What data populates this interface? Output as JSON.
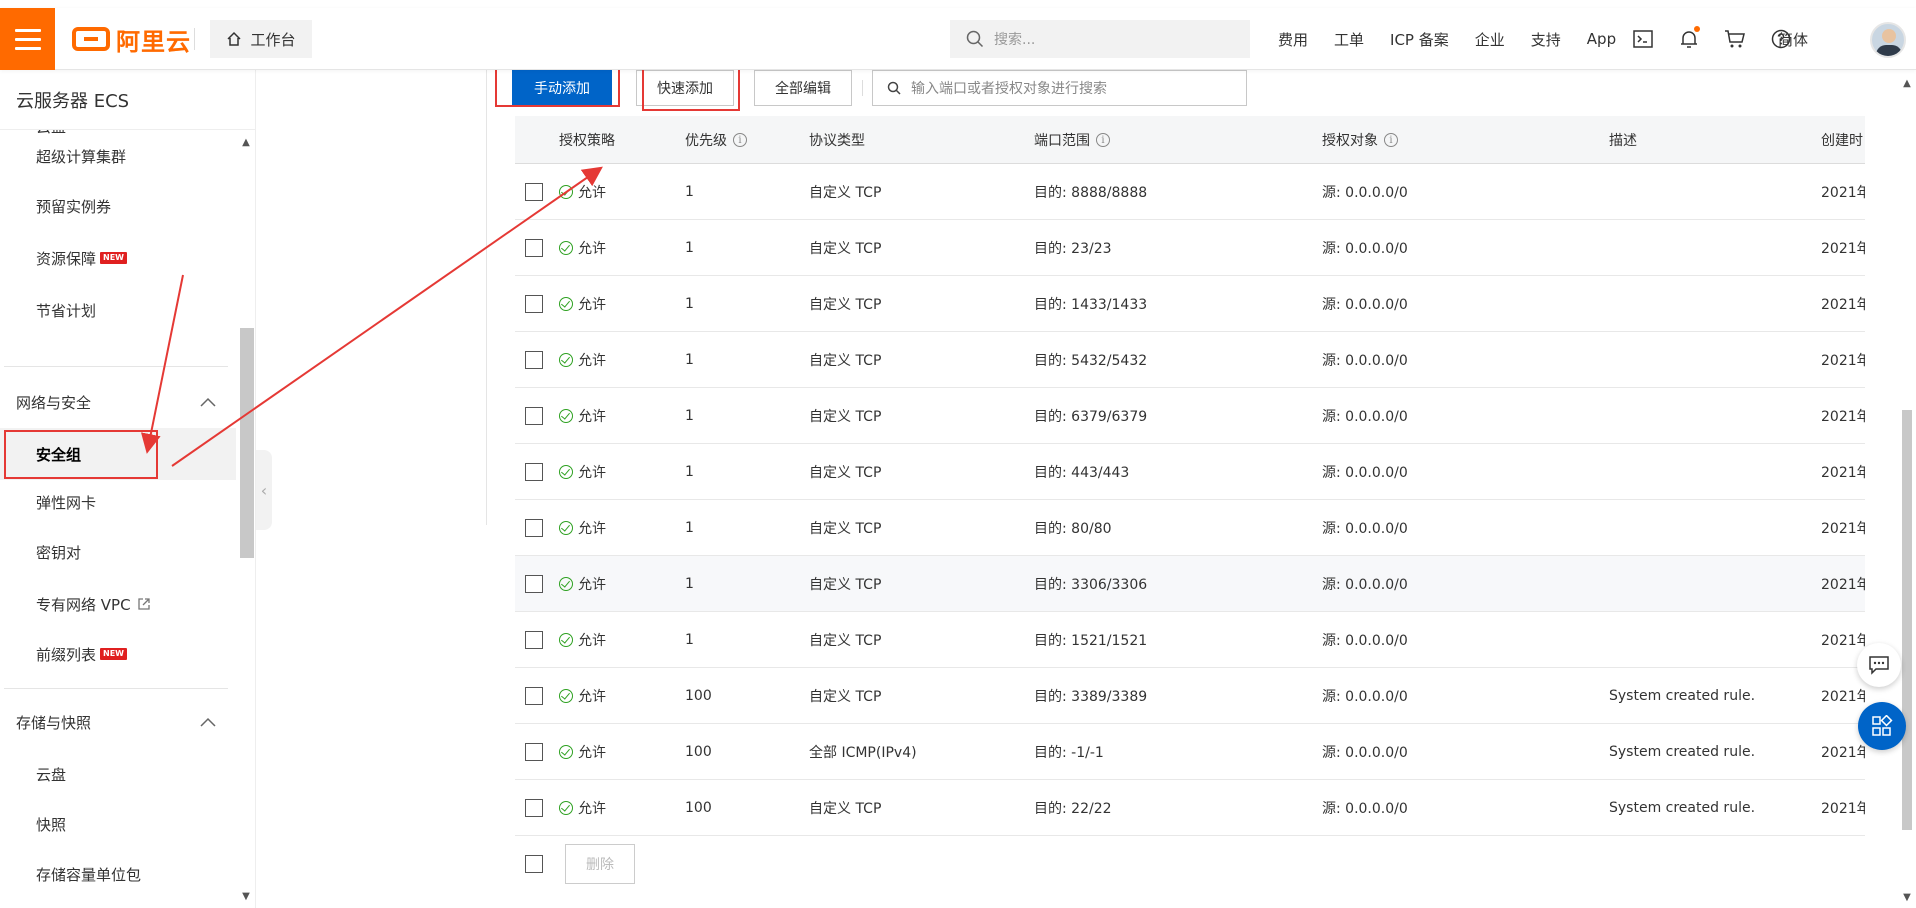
{
  "header": {
    "brand": "阿里云",
    "workbench": "工作台",
    "search_placeholder": "搜索...",
    "links": [
      "费用",
      "工单",
      "ICP 备案",
      "企业",
      "支持",
      "App"
    ],
    "language": "简体",
    "accent_color": "#ff6a00"
  },
  "sidebar": {
    "title": "云服务器 ECS",
    "partial_top": "云盘",
    "items_top": [
      {
        "label": "超级计算集群",
        "new": false
      },
      {
        "label": "预留实例券",
        "new": false
      },
      {
        "label": "资源保障",
        "new": true
      },
      {
        "label": "节省计划",
        "new": false
      }
    ],
    "group_network": "网络与安全",
    "items_network": [
      {
        "label": "安全组",
        "active": true
      },
      {
        "label": "弹性网卡"
      },
      {
        "label": "密钥对"
      },
      {
        "label": "专有网络 VPC"
      },
      {
        "label": "前缀列表"
      }
    ],
    "group_storage": "存储与快照",
    "items_storage": [
      "云盘",
      "快照",
      "存储容量单位包"
    ],
    "new_badge": "NEW"
  },
  "toolbar": {
    "manual_add": "手动添加",
    "quick_add": "快速添加",
    "edit_all": "全部编辑",
    "search_placeholder": "输入端口或者授权对象进行搜索"
  },
  "table": {
    "columns": [
      "授权策略",
      "优先级",
      "协议类型",
      "端口范围",
      "授权对象",
      "描述",
      "创建时"
    ],
    "rows": [
      {
        "policy": "允许",
        "priority": "1",
        "protocol": "自定义 TCP",
        "port": "目的: 8888/8888",
        "source": "源: 0.0.0.0/0",
        "desc": "",
        "created": "2021年"
      },
      {
        "policy": "允许",
        "priority": "1",
        "protocol": "自定义 TCP",
        "port": "目的: 23/23",
        "source": "源: 0.0.0.0/0",
        "desc": "",
        "created": "2021年"
      },
      {
        "policy": "允许",
        "priority": "1",
        "protocol": "自定义 TCP",
        "port": "目的: 1433/1433",
        "source": "源: 0.0.0.0/0",
        "desc": "",
        "created": "2021年"
      },
      {
        "policy": "允许",
        "priority": "1",
        "protocol": "自定义 TCP",
        "port": "目的: 5432/5432",
        "source": "源: 0.0.0.0/0",
        "desc": "",
        "created": "2021年"
      },
      {
        "policy": "允许",
        "priority": "1",
        "protocol": "自定义 TCP",
        "port": "目的: 6379/6379",
        "source": "源: 0.0.0.0/0",
        "desc": "",
        "created": "2021年"
      },
      {
        "policy": "允许",
        "priority": "1",
        "protocol": "自定义 TCP",
        "port": "目的: 443/443",
        "source": "源: 0.0.0.0/0",
        "desc": "",
        "created": "2021年"
      },
      {
        "policy": "允许",
        "priority": "1",
        "protocol": "自定义 TCP",
        "port": "目的: 80/80",
        "source": "源: 0.0.0.0/0",
        "desc": "",
        "created": "2021年"
      },
      {
        "policy": "允许",
        "priority": "1",
        "protocol": "自定义 TCP",
        "port": "目的: 3306/3306",
        "source": "源: 0.0.0.0/0",
        "desc": "",
        "created": "2021年"
      },
      {
        "policy": "允许",
        "priority": "1",
        "protocol": "自定义 TCP",
        "port": "目的: 1521/1521",
        "source": "源: 0.0.0.0/0",
        "desc": "",
        "created": "2021年"
      },
      {
        "policy": "允许",
        "priority": "100",
        "protocol": "自定义 TCP",
        "port": "目的: 3389/3389",
        "source": "源: 0.0.0.0/0",
        "desc": "System created rule.",
        "created": "2021年"
      },
      {
        "policy": "允许",
        "priority": "100",
        "protocol": "全部 ICMP(IPv4)",
        "port": "目的: -1/-1",
        "source": "源: 0.0.0.0/0",
        "desc": "System created rule.",
        "created": "2021年"
      },
      {
        "policy": "允许",
        "priority": "100",
        "protocol": "自定义 TCP",
        "port": "目的: 22/22",
        "source": "源: 0.0.0.0/0",
        "desc": "System created rule.",
        "created": "2021年"
      }
    ],
    "delete_label": "删除"
  },
  "colors": {
    "primary": "#0064c8",
    "allow_green": "#2ea121",
    "annotation_red": "#e53935"
  }
}
